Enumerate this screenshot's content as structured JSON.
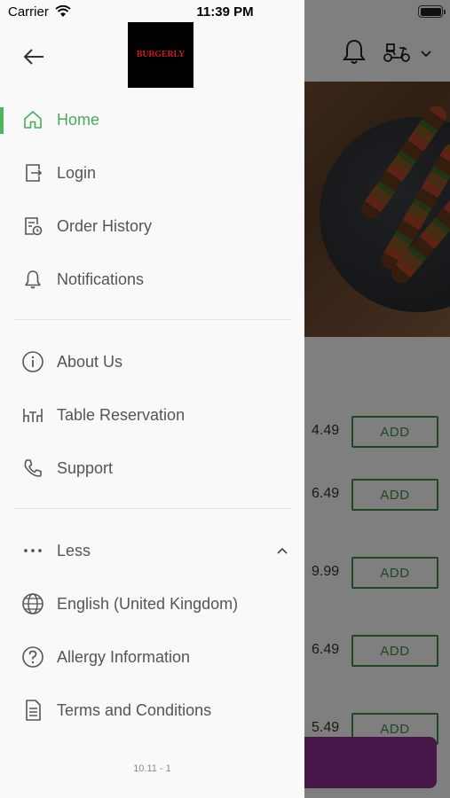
{
  "status_bar": {
    "carrier": "Carrier",
    "time": "11:39 PM"
  },
  "header": {
    "logo_text": "BURGERLY",
    "icons": [
      "back-arrow-icon",
      "bell-icon",
      "scooter-icon",
      "chevron-down-icon"
    ]
  },
  "menu": {
    "primary": [
      {
        "label": "Home",
        "icon": "home-icon",
        "active": true
      },
      {
        "label": "Login",
        "icon": "login-icon"
      },
      {
        "label": "Order History",
        "icon": "order-history-icon"
      },
      {
        "label": "Notifications",
        "icon": "bell-icon"
      }
    ],
    "secondary": [
      {
        "label": "About Us",
        "icon": "info-icon"
      },
      {
        "label": "Table Reservation",
        "icon": "table-icon"
      },
      {
        "label": "Support",
        "icon": "phone-icon"
      }
    ],
    "more": [
      {
        "label": "Less",
        "icon": "more-dots-icon"
      },
      {
        "label": "English (United Kingdom)",
        "icon": "globe-icon"
      },
      {
        "label": "Allergy Information",
        "icon": "question-icon"
      },
      {
        "label": "Terms and Conditions",
        "icon": "document-icon"
      }
    ]
  },
  "version": "10.11 - 1",
  "background": {
    "products": [
      {
        "price": "4.49",
        "add_label": "ADD"
      },
      {
        "price": "6.49",
        "add_label": "ADD"
      },
      {
        "price": "9.99",
        "add_label": "ADD"
      },
      {
        "price": "6.49",
        "add_label": "ADD"
      },
      {
        "price": "5.49",
        "add_label": "ADD"
      }
    ]
  },
  "colors": {
    "accent_green": "#4cb85c",
    "cart_purple": "#8b2d8f",
    "add_green": "#3b8f4a"
  }
}
